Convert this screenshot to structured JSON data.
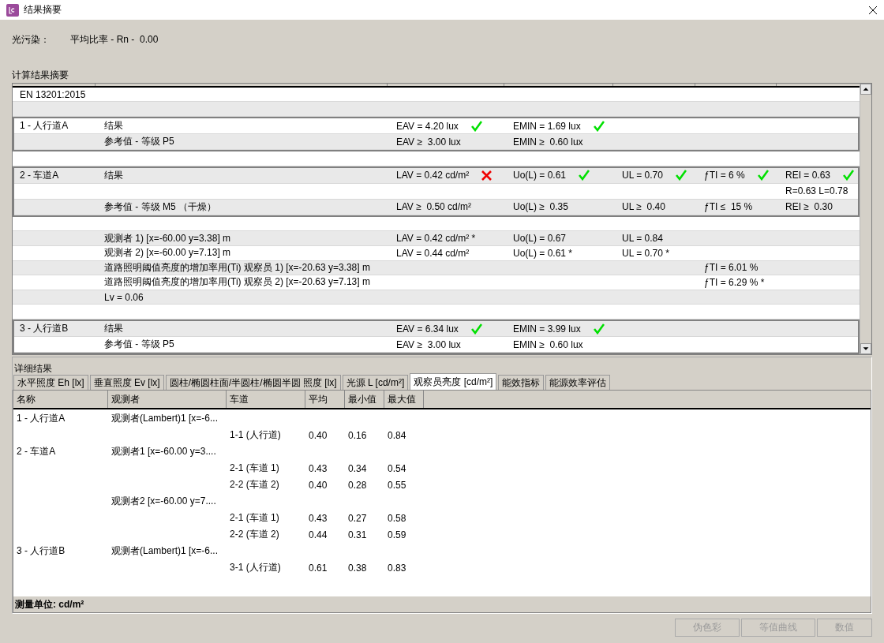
{
  "window": {
    "title": "结果摘要"
  },
  "light_pollution": {
    "label": "光污染：",
    "text": "平均比率 - Rn -  0.00"
  },
  "summary": {
    "title": "计算结果摘要",
    "rows": [
      {
        "kind": "standard",
        "text": "EN 13201:2015"
      },
      {
        "kind": "blank"
      },
      {
        "kind": "group",
        "rows": [
          {
            "name": "1 - 人行道A",
            "label": "结果",
            "cells": [
              {
                "text": "EAV = 4.20 lux",
                "ok": true
              },
              {
                "text": "EMIN = 1.69 lux",
                "ok": true
              },
              null,
              null,
              null
            ]
          },
          {
            "label": "参考值 - 等级 P5",
            "cells": [
              {
                "text": "EAV ≥  3.00 lux"
              },
              {
                "text": "EMIN ≥  0.60 lux"
              },
              null,
              null,
              null
            ]
          }
        ]
      },
      {
        "kind": "blank"
      },
      {
        "kind": "group",
        "rows": [
          {
            "name": "2 - 车道A",
            "label": "结果",
            "cells": [
              {
                "text": "LAV = 0.42 cd/m²",
                "ok": false
              },
              {
                "text": "Uo(L) = 0.61",
                "ok": true
              },
              {
                "text": "UL = 0.70",
                "ok": true
              },
              {
                "text": "ƒTI = 6 %",
                "ok": true
              },
              {
                "text": "REI = 0.63",
                "ok": true
              }
            ]
          },
          {
            "cells": [
              null,
              null,
              null,
              null,
              {
                "text": "R=0.63 L=0.78"
              }
            ]
          },
          {
            "label": "参考值 - 等级 M5 （干燥）",
            "cells": [
              {
                "text": "LAV ≥  0.50 cd/m²"
              },
              {
                "text": "Uo(L) ≥  0.35"
              },
              {
                "text": "UL ≥  0.40"
              },
              {
                "text": "ƒTI ≤  15 %"
              },
              {
                "text": "REI ≥  0.30"
              }
            ]
          }
        ]
      },
      {
        "kind": "blank"
      },
      {
        "kind": "row",
        "label": "观测者 1) [x=-60.00 y=3.38] m",
        "cells": [
          {
            "text": "LAV = 0.42 cd/m² *"
          },
          {
            "text": "Uo(L) = 0.67"
          },
          {
            "text": "UL = 0.84"
          },
          null,
          null
        ]
      },
      {
        "kind": "row",
        "label": "观测者 2) [x=-60.00 y=7.13] m",
        "cells": [
          {
            "text": "LAV = 0.44 cd/m²"
          },
          {
            "text": "Uo(L) = 0.61 *"
          },
          {
            "text": "UL = 0.70 *"
          },
          null,
          null
        ]
      },
      {
        "kind": "row",
        "label": "道路照明阈值亮度的增加率用(Ti) 观察员 1) [x=-20.63 y=3.38] m",
        "cells": [
          null,
          null,
          null,
          {
            "text": "ƒTI = 6.01 %"
          },
          null
        ]
      },
      {
        "kind": "row",
        "label": "道路照明阈值亮度的增加率用(Ti) 观察员 2) [x=-20.63 y=7.13] m",
        "cells": [
          null,
          null,
          null,
          {
            "text": "ƒTI = 6.29 % *"
          },
          null
        ]
      },
      {
        "kind": "row",
        "label": "Lv = 0.06",
        "cells": [
          null,
          null,
          null,
          null,
          null
        ]
      },
      {
        "kind": "blank"
      },
      {
        "kind": "group",
        "rows": [
          {
            "name": "3 - 人行道B",
            "label": "结果",
            "cells": [
              {
                "text": "EAV = 6.34 lux",
                "ok": true
              },
              {
                "text": "EMIN = 3.99 lux",
                "ok": true
              },
              null,
              null,
              null
            ]
          },
          {
            "label": "参考值 - 等级 P5",
            "cells": [
              {
                "text": "EAV ≥  3.00 lux"
              },
              {
                "text": "EMIN ≥  0.60 lux"
              },
              null,
              null,
              null
            ]
          }
        ]
      }
    ]
  },
  "details": {
    "title": "详细结果",
    "tabs": [
      {
        "label": "水平照度 Eh [lx]",
        "selected": false
      },
      {
        "label": "垂直照度 Ev [lx]",
        "selected": false
      },
      {
        "label": "圆柱/椭圆柱面/半圆柱/椭圆半圆 照度 [lx]",
        "selected": false
      },
      {
        "label": "光源 L [cd/m²]",
        "selected": false
      },
      {
        "label": "观察员亮度 [cd/m²]",
        "selected": true
      },
      {
        "label": "能效指标",
        "selected": false
      },
      {
        "label": "能源效率评估",
        "selected": false
      }
    ],
    "columns": [
      "名称",
      "观测者",
      "车道",
      "平均",
      "最小值",
      "最大值"
    ],
    "rows": [
      {
        "name": "1 - 人行道A",
        "observer": "观测者(Lambert)1 [x=-6..."
      },
      {
        "lane": "1-1 (人行道)",
        "avg": "0.40",
        "min": "0.16",
        "max": "0.84"
      },
      {
        "name": "2 - 车道A",
        "observer": "观测者1 [x=-60.00 y=3...."
      },
      {
        "lane": "2-1 (车道 1)",
        "avg": "0.43",
        "min": "0.34",
        "max": "0.54"
      },
      {
        "lane": "2-2 (车道 2)",
        "avg": "0.40",
        "min": "0.28",
        "max": "0.55"
      },
      {
        "observer": "观测者2 [x=-60.00 y=7...."
      },
      {
        "lane": "2-1 (车道 1)",
        "avg": "0.43",
        "min": "0.27",
        "max": "0.58"
      },
      {
        "lane": "2-2 (车道 2)",
        "avg": "0.44",
        "min": "0.31",
        "max": "0.59"
      },
      {
        "name": "3 - 人行道B",
        "observer": "观测者(Lambert)1 [x=-6..."
      },
      {
        "lane": "3-1 (人行道)",
        "avg": "0.61",
        "min": "0.38",
        "max": "0.83"
      }
    ],
    "unit": "测量单位: cd/m²"
  },
  "buttons": [
    {
      "label": "伪色彩",
      "disabled": true
    },
    {
      "label": "等值曲线",
      "disabled": true
    },
    {
      "label": "数值",
      "disabled": true
    }
  ]
}
